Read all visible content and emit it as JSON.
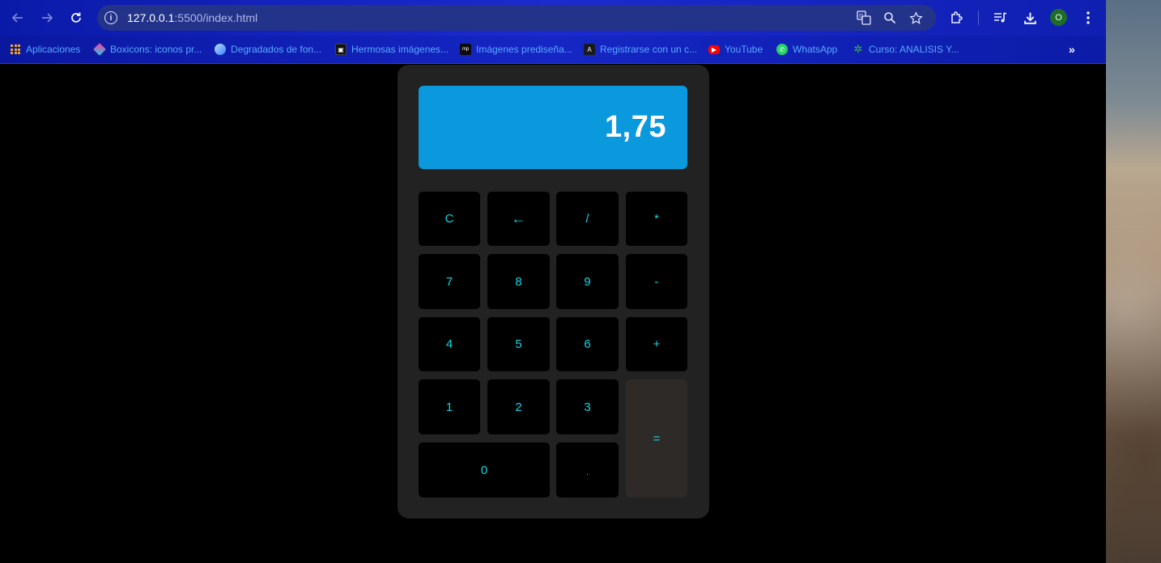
{
  "browser": {
    "url_host": "127.0.0.1",
    "url_path": ":5500/index.html",
    "profile_initial": "O",
    "icons": {
      "back": "arrow-left-icon",
      "forward": "arrow-right-icon",
      "reload": "reload-icon",
      "site_info": "info-icon",
      "translate": "translate-icon",
      "zoom": "zoom-icon",
      "bookmark": "star-icon",
      "extensions": "puzzle-icon",
      "media": "media-control-icon",
      "downloads": "download-icon",
      "menu": "kebab-menu-icon"
    }
  },
  "bookmarks": [
    {
      "label": "Aplicaciones",
      "icon": "apps-grid-icon"
    },
    {
      "label": "Boxicons: iconos pr...",
      "icon": "boxicons-icon"
    },
    {
      "label": "Degradados de fon...",
      "icon": "gradient-icon"
    },
    {
      "label": "Hermosas imágenes...",
      "icon": "images-icon"
    },
    {
      "label": "Imágenes prediseña...",
      "icon": "clipart-icon"
    },
    {
      "label": "Registrarse con un c...",
      "icon": "angular-icon"
    },
    {
      "label": "YouTube",
      "icon": "youtube-icon"
    },
    {
      "label": "WhatsApp",
      "icon": "whatsapp-icon"
    },
    {
      "label": "Curso: ANALISIS Y...",
      "icon": "sena-icon"
    }
  ],
  "calculator": {
    "display": "1,75",
    "keys": {
      "clear": "C",
      "backspace": "←",
      "divide": "/",
      "multiply": "*",
      "seven": "7",
      "eight": "8",
      "nine": "9",
      "minus": "-",
      "four": "4",
      "five": "5",
      "six": "6",
      "plus": "+",
      "one": "1",
      "two": "2",
      "three": "3",
      "equals": "=",
      "zero": "0",
      "dot": "."
    }
  },
  "colors": {
    "display_bg": "#0a99dc",
    "key_text": "#12d6e4",
    "body_bg": "#222222"
  }
}
